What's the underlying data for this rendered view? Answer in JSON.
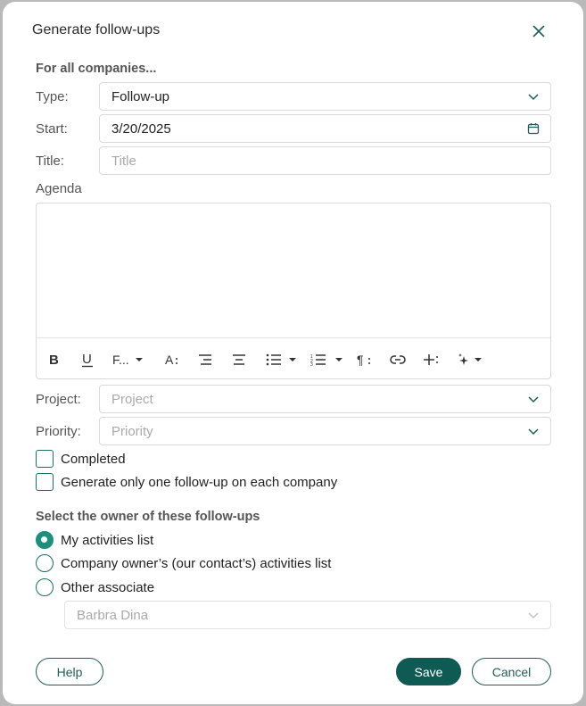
{
  "dialog": {
    "title": "Generate follow-ups",
    "section_all": "For all companies...",
    "type": {
      "label": "Type:",
      "value": "Follow-up"
    },
    "start": {
      "label": "Start:",
      "value": "3/20/2025"
    },
    "title_field": {
      "label": "Title:",
      "placeholder": "Title"
    },
    "agenda": {
      "label": "Agenda"
    },
    "toolbar": {
      "font_label": "F..."
    },
    "project": {
      "label": "Project:",
      "placeholder": "Project"
    },
    "priority": {
      "label": "Priority:",
      "placeholder": "Priority"
    },
    "completed": {
      "label": "Completed",
      "checked": false
    },
    "one_per_company": {
      "label": "Generate only one follow-up on each company",
      "checked": false
    },
    "owner_section": "Select the owner of these follow-ups",
    "owner_options": [
      {
        "label": "My activities list",
        "selected": true
      },
      {
        "label": "Company owner’s (our contact’s) activities list",
        "selected": false
      },
      {
        "label": "Other associate",
        "selected": false
      }
    ],
    "associate": {
      "value": "Barbra Dina"
    },
    "buttons": {
      "help": "Help",
      "save": "Save",
      "cancel": "Cancel"
    }
  },
  "colors": {
    "accent": "#0f5a52",
    "radio_on": "#1f8f7d",
    "border": "#d9d9d9"
  }
}
